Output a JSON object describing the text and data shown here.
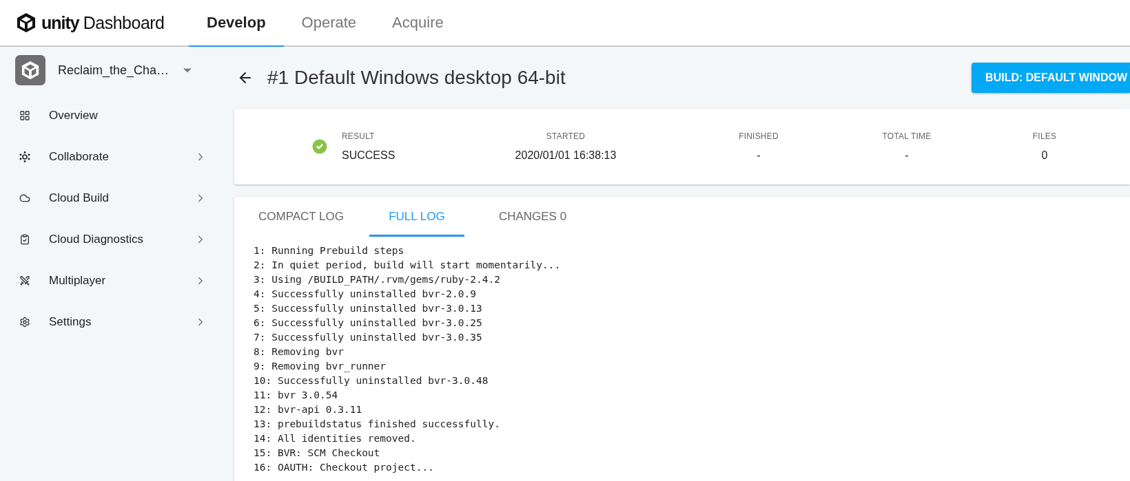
{
  "header": {
    "logo": "unity",
    "product": "Dashboard",
    "tabs": [
      {
        "label": "Develop",
        "selected": true
      },
      {
        "label": "Operate",
        "selected": false
      },
      {
        "label": "Acquire",
        "selected": false
      }
    ]
  },
  "sidebar": {
    "project": "Reclaim_the_Cha…",
    "items": [
      {
        "label": "Overview",
        "expandable": false
      },
      {
        "label": "Collaborate",
        "expandable": true
      },
      {
        "label": "Cloud Build",
        "expandable": true
      },
      {
        "label": "Cloud Diagnostics",
        "expandable": true
      },
      {
        "label": "Multiplayer",
        "expandable": true
      },
      {
        "label": "Settings",
        "expandable": true
      }
    ]
  },
  "page": {
    "title": "#1 Default Windows desktop 64-bit",
    "action_button": "BUILD: DEFAULT WINDOW"
  },
  "summary": {
    "succeeded": true,
    "columns": [
      {
        "label": "RESULT",
        "value": "SUCCESS"
      },
      {
        "label": "STARTED",
        "value": "2020/01/01 16:38:13"
      },
      {
        "label": "FINISHED",
        "value": "-"
      },
      {
        "label": "TOTAL TIME",
        "value": "-"
      },
      {
        "label": "FILES",
        "value": "0"
      }
    ]
  },
  "log_tabs": [
    {
      "label": "COMPACT LOG",
      "selected": false
    },
    {
      "label": "FULL LOG",
      "selected": true
    },
    {
      "label": "CHANGES 0",
      "selected": false
    }
  ],
  "log_lines": [
    "1: Running Prebuild steps",
    "2: In quiet period, build will start momentarily...",
    "3: Using /BUILD_PATH/.rvm/gems/ruby-2.4.2",
    "4: Successfully uninstalled bvr-2.0.9",
    "5: Successfully uninstalled bvr-3.0.13",
    "6: Successfully uninstalled bvr-3.0.25",
    "7: Successfully uninstalled bvr-3.0.35",
    "8: Removing bvr",
    "9: Removing bvr_runner",
    "10: Successfully uninstalled bvr-3.0.48",
    "11: bvr 3.0.54",
    "12: bvr-api 0.3.11",
    "13: prebuildstatus finished successfully.",
    "14: All identities removed.",
    "15: BVR: SCM Checkout",
    "16: OAUTH: Checkout project..."
  ]
}
